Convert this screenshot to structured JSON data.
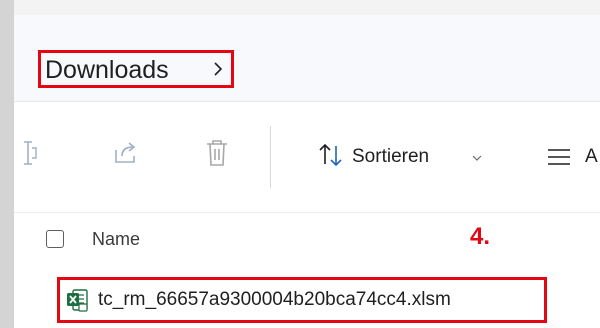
{
  "breadcrumb": {
    "folder": "Downloads"
  },
  "toolbar": {
    "sort_label": "Sortieren",
    "more_label": "A"
  },
  "header": {
    "name_column": "Name"
  },
  "annotation": {
    "step": "4."
  },
  "files": [
    {
      "name": "tc_rm_66657a9300004b20bca74cc4.xlsm",
      "icon": "excel-icon"
    }
  ],
  "colors": {
    "highlight": "#e30613",
    "excel_green": "#1d6f42"
  }
}
